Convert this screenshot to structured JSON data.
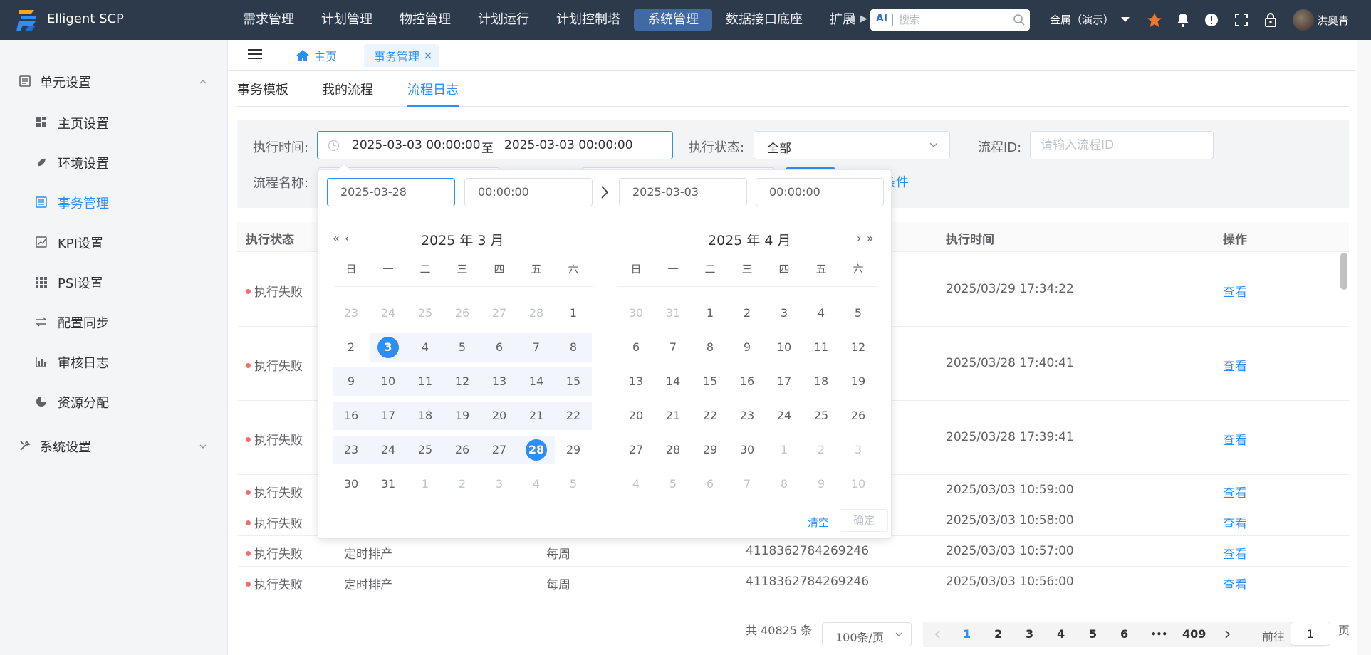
{
  "app": {
    "brand": "Elligent SCP"
  },
  "topnav": {
    "items": [
      "需求管理",
      "计划管理",
      "物控管理",
      "计划运行",
      "计划控制塔",
      "系统管理",
      "数据接口底座",
      "扩展"
    ],
    "active_index": 5
  },
  "search": {
    "ai_label": "AI",
    "placeholder": "搜索"
  },
  "header": {
    "tenant": "金属（演示）",
    "user": "洪奥青"
  },
  "sidebar": {
    "groups": [
      {
        "label": "单元设置",
        "expanded": true
      },
      {
        "label": "系统设置",
        "expanded": false
      }
    ],
    "items": [
      {
        "label": "主页设置",
        "icon": "dashboard-icon"
      },
      {
        "label": "环境设置",
        "icon": "palette-icon"
      },
      {
        "label": "事务管理",
        "icon": "list-icon",
        "active": true
      },
      {
        "label": "KPI设置",
        "icon": "chart-line-icon"
      },
      {
        "label": "PSI设置",
        "icon": "grid-icon"
      },
      {
        "label": "配置同步",
        "icon": "sync-icon"
      },
      {
        "label": "审核日志",
        "icon": "bar-chart-icon"
      },
      {
        "label": "资源分配",
        "icon": "pie-chart-icon"
      }
    ]
  },
  "tabs": {
    "home": "主页",
    "active": "事务管理"
  },
  "subtabs": {
    "items": [
      "事务模板",
      "我的流程",
      "流程日志"
    ],
    "active_index": 2
  },
  "filter": {
    "exec_time_label": "执行时间:",
    "range_start": "2025-03-03 00:00:00",
    "range_sep": "至",
    "range_end": "2025-03-03 00:00:00",
    "status_label": "执行状态:",
    "status_value": "全部",
    "flow_id_label": "流程ID:",
    "flow_id_placeholder": "请输入流程ID",
    "flow_name_label": "流程名称:",
    "more_conditions_partial": "条件"
  },
  "table": {
    "headers": {
      "status": "执行状态",
      "exec_time": "执行时间",
      "action": "操作"
    },
    "rows": [
      {
        "status": "执行失败",
        "name": "",
        "cycle": "",
        "id": "",
        "time": "2025/03/29 17:34:22",
        "action": "查看"
      },
      {
        "status": "执行失败",
        "name": "",
        "cycle": "",
        "id": "",
        "time": "2025/03/28 17:40:41",
        "action": "查看"
      },
      {
        "status": "执行失败",
        "name": "",
        "cycle": "",
        "id": "",
        "time": "2025/03/28 17:39:41",
        "action": "查看"
      },
      {
        "status": "执行失败",
        "name": "",
        "cycle": "",
        "id": "",
        "time": "2025/03/03 10:59:00",
        "action": "查看"
      },
      {
        "status": "执行失败",
        "name": "",
        "cycle": "",
        "id": "",
        "time": "2025/03/03 10:58:00",
        "action": "查看"
      },
      {
        "status": "执行失败",
        "name": "定时排产",
        "cycle": "每周",
        "id": "4118362784269246",
        "time": "2025/03/03 10:57:00",
        "action": "查看"
      },
      {
        "status": "执行失败",
        "name": "定时排产",
        "cycle": "每周",
        "id": "4118362784269246",
        "time": "2025/03/03 10:56:00",
        "action": "查看"
      }
    ]
  },
  "pagination": {
    "total": "共 40825 条",
    "page_size": "100条/页",
    "pages": [
      "1",
      "2",
      "3",
      "4",
      "5",
      "6"
    ],
    "ellipsis": "•••",
    "last_page": "409",
    "current": "1",
    "goto_prefix": "前往",
    "goto_value": "1",
    "goto_suffix": "页"
  },
  "datepicker": {
    "start_date": "2025-03-28",
    "start_time": "00:00:00",
    "end_date": "2025-03-03",
    "end_time": "00:00:00",
    "left_title": "2025 年 3 月",
    "right_title": "2025 年 4 月",
    "weekdays": [
      "日",
      "一",
      "二",
      "三",
      "四",
      "五",
      "六"
    ],
    "left_days": [
      "23",
      "24",
      "25",
      "26",
      "27",
      "28",
      "1",
      "2",
      "3",
      "4",
      "5",
      "6",
      "7",
      "8",
      "9",
      "10",
      "11",
      "12",
      "13",
      "14",
      "15",
      "16",
      "17",
      "18",
      "19",
      "20",
      "21",
      "22",
      "23",
      "24",
      "25",
      "26",
      "27",
      "28",
      "29",
      "30",
      "31",
      "1",
      "2",
      "3",
      "4",
      "5"
    ],
    "left_other_before": 6,
    "left_other_after_from": 37,
    "left_range": [
      8,
      33
    ],
    "left_selected": [
      8,
      33
    ],
    "right_days": [
      "30",
      "31",
      "1",
      "2",
      "3",
      "4",
      "5",
      "6",
      "7",
      "8",
      "9",
      "10",
      "11",
      "12",
      "13",
      "14",
      "15",
      "16",
      "17",
      "18",
      "19",
      "20",
      "21",
      "22",
      "23",
      "24",
      "25",
      "26",
      "27",
      "28",
      "29",
      "30",
      "1",
      "2",
      "3",
      "4",
      "5",
      "6",
      "7",
      "8",
      "9",
      "10"
    ],
    "right_other_before": 2,
    "right_other_after_from": 32,
    "clear_label": "清空",
    "confirm_label": "确定"
  }
}
